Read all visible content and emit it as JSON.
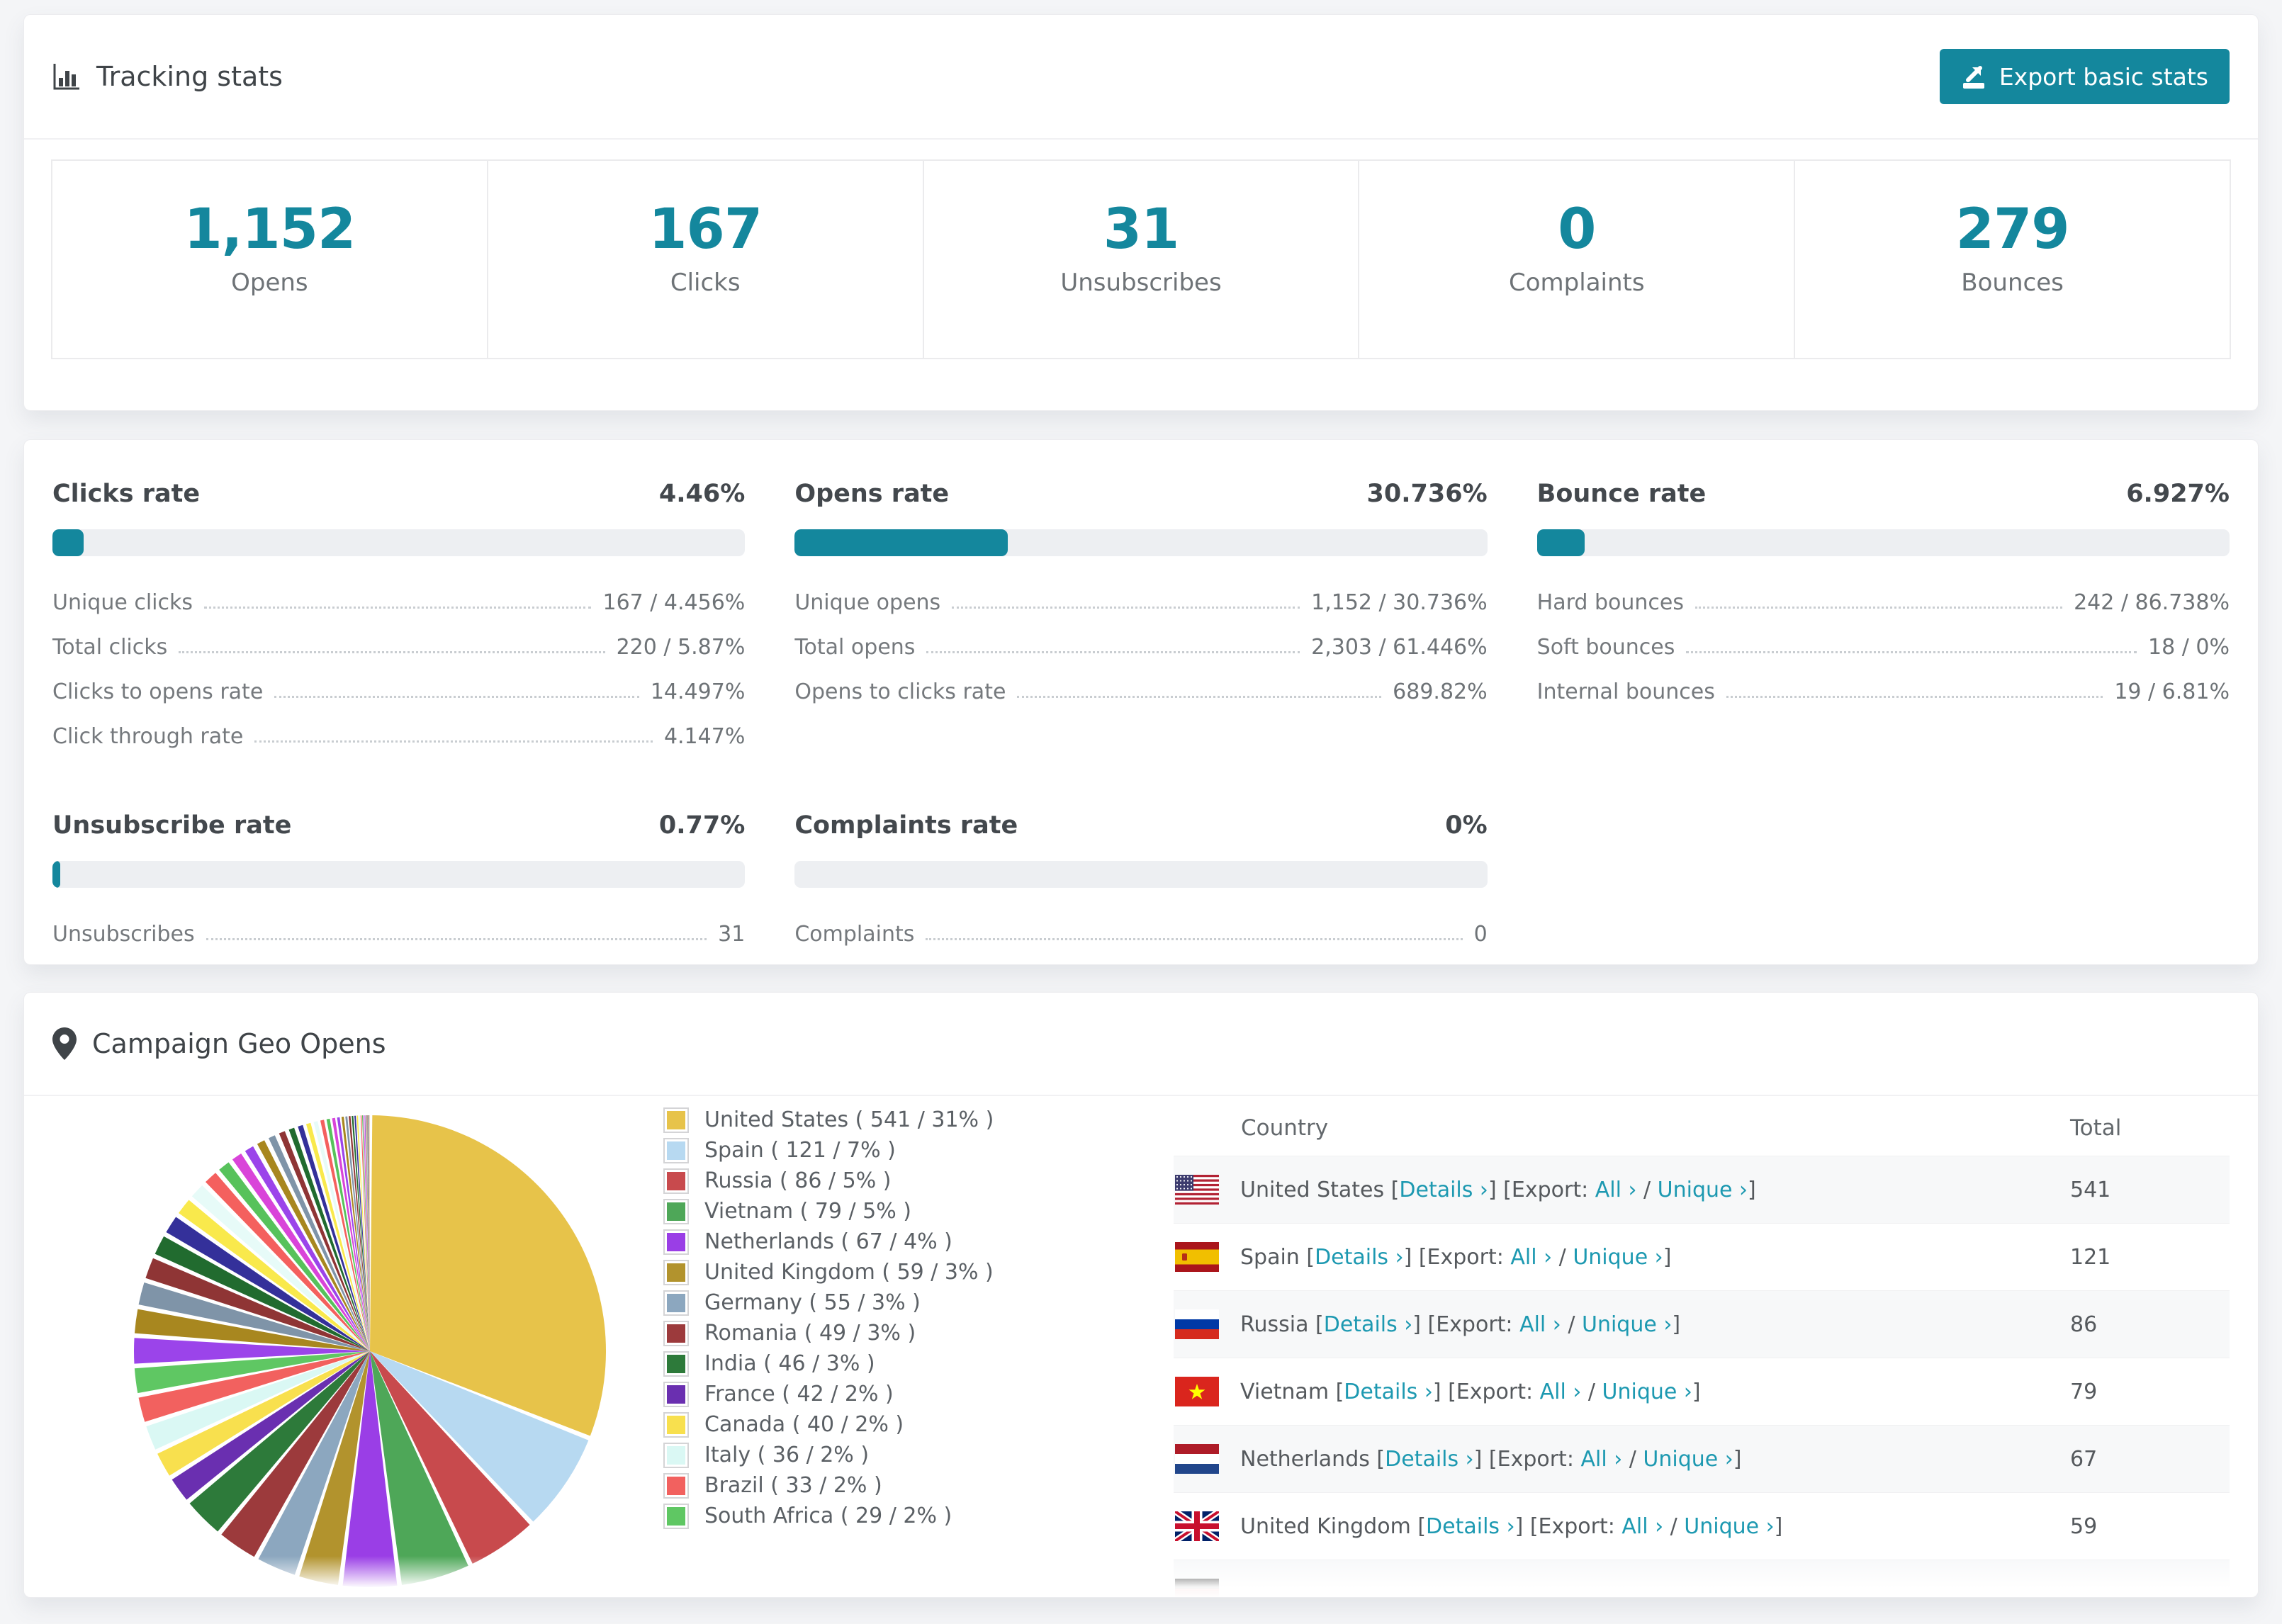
{
  "accent": "#14879d",
  "link_color": "#1d99b1",
  "tracking": {
    "title": "Tracking stats",
    "export_button": "Export basic stats",
    "stats": [
      {
        "value": "1,152",
        "label": "Opens"
      },
      {
        "value": "167",
        "label": "Clicks"
      },
      {
        "value": "31",
        "label": "Unsubscribes"
      },
      {
        "value": "0",
        "label": "Complaints"
      },
      {
        "value": "279",
        "label": "Bounces"
      }
    ]
  },
  "rates": {
    "blocks": [
      {
        "title": "Clicks rate",
        "value": "4.46%",
        "pct": 4.46,
        "rows": [
          [
            "Unique clicks",
            "167 / 4.456%"
          ],
          [
            "Total clicks",
            "220 / 5.87%"
          ],
          [
            "Clicks to opens rate",
            "14.497%"
          ],
          [
            "Click through rate",
            "4.147%"
          ]
        ]
      },
      {
        "title": "Opens rate",
        "value": "30.736%",
        "pct": 30.736,
        "rows": [
          [
            "Unique opens",
            "1,152 / 30.736%"
          ],
          [
            "Total opens",
            "2,303 / 61.446%"
          ],
          [
            "Opens to clicks rate",
            "689.82%"
          ]
        ]
      },
      {
        "title": "Bounce rate",
        "value": "6.927%",
        "pct": 6.927,
        "rows": [
          [
            "Hard bounces",
            "242 / 86.738%"
          ],
          [
            "Soft bounces",
            "18 / 0%"
          ],
          [
            "Internal bounces",
            "19 / 6.81%"
          ]
        ]
      },
      {
        "title": "Unsubscribe rate",
        "value": "0.77%",
        "pct": 0.77,
        "rows": [
          [
            "Unsubscribes",
            "31"
          ]
        ]
      },
      {
        "title": "Complaints rate",
        "value": "0%",
        "pct": 0,
        "rows": [
          [
            "Complaints",
            "0"
          ]
        ]
      }
    ]
  },
  "geo": {
    "title": "Campaign Geo Opens",
    "table": {
      "headers": [
        "Country",
        "Total"
      ],
      "tokens": {
        "open": "[",
        "close": "]",
        "export": "Export:",
        "slash": "/"
      },
      "links": {
        "details": "Details ›",
        "all": "All ›",
        "unique": "Unique ›"
      },
      "rows": [
        {
          "country": "United States",
          "flag": "us",
          "total": "541"
        },
        {
          "country": "Spain",
          "flag": "es",
          "total": "121"
        },
        {
          "country": "Russia",
          "flag": "ru",
          "total": "86"
        },
        {
          "country": "Vietnam",
          "flag": "vn",
          "total": "79"
        },
        {
          "country": "Netherlands",
          "flag": "nl",
          "total": "67"
        },
        {
          "country": "United Kingdom",
          "flag": "gb",
          "total": "59"
        },
        {
          "country": "",
          "flag": "de",
          "total": "",
          "partial": true
        }
      ]
    }
  },
  "chart_data": {
    "type": "pie",
    "title": "Campaign Geo Opens",
    "legend_position": "right",
    "start_angle_deg": 0,
    "slices": [
      {
        "label": "United States",
        "value": 541,
        "pct": 31,
        "color": "#e7c34a",
        "legend": "United States ( 541 / 31% )"
      },
      {
        "label": "Spain",
        "value": 121,
        "pct": 7,
        "color": "#b7d9f1",
        "legend": "Spain ( 121 / 7% )"
      },
      {
        "label": "Russia",
        "value": 86,
        "pct": 5,
        "color": "#c84a4d",
        "legend": "Russia ( 86 / 5% )"
      },
      {
        "label": "Vietnam",
        "value": 79,
        "pct": 5,
        "color": "#4ea758",
        "legend": "Vietnam ( 79 / 5% )"
      },
      {
        "label": "Netherlands",
        "value": 67,
        "pct": 4,
        "color": "#9a3ee6",
        "legend": "Netherlands ( 67 / 4% )"
      },
      {
        "label": "United Kingdom",
        "value": 59,
        "pct": 3,
        "color": "#b2932d",
        "legend": "United Kingdom ( 59 / 3% )"
      },
      {
        "label": "Germany",
        "value": 55,
        "pct": 3,
        "color": "#8ca7bf",
        "legend": "Germany ( 55 / 3% )"
      },
      {
        "label": "Romania",
        "value": 49,
        "pct": 3,
        "color": "#9c3a3c",
        "legend": "Romania ( 49 / 3% )"
      },
      {
        "label": "India",
        "value": 46,
        "pct": 3,
        "color": "#2d7a3a",
        "legend": "India ( 46 / 3% )"
      },
      {
        "label": "France",
        "value": 42,
        "pct": 2,
        "color": "#6a2fb0",
        "legend": "France ( 42 / 2% )"
      },
      {
        "label": "Canada",
        "value": 40,
        "pct": 2,
        "color": "#f8e04e",
        "legend": "Canada ( 40 / 2% )"
      },
      {
        "label": "Italy",
        "value": 36,
        "pct": 2,
        "color": "#daf8f4",
        "legend": "Italy ( 36 / 2% )"
      },
      {
        "label": "Brazil",
        "value": 33,
        "pct": 2,
        "color": "#f2615f",
        "legend": "Brazil ( 33 / 2% )"
      },
      {
        "label": "South Africa",
        "value": 29,
        "pct": 2,
        "color": "#5fc763",
        "legend": "South Africa ( 29 / 2% )"
      }
    ],
    "other_segments": {
      "note": "unlabeled small slices, approx relative weights, clockwise after South Africa",
      "weights": [
        1.0,
        0.95,
        0.9,
        0.85,
        0.8,
        0.75,
        0.7,
        0.65,
        0.6,
        0.55,
        0.5,
        0.46,
        0.42,
        0.38,
        0.35,
        0.32,
        0.29,
        0.26,
        0.23,
        0.21,
        0.19,
        0.17,
        0.15,
        0.13,
        0.115,
        0.1,
        0.09,
        0.08,
        0.07,
        0.06,
        0.052,
        0.045,
        0.04,
        0.035,
        0.03,
        0.026,
        0.022,
        0.019,
        0.016,
        0.013,
        0.011,
        0.009
      ],
      "colors": [
        "#9b44ea",
        "#a8871f",
        "#7f94a8",
        "#8f3535",
        "#216b2f",
        "#34309a",
        "#f9e94c",
        "#e7fbf8",
        "#f4605e",
        "#57c25b",
        "#d944d9"
      ]
    }
  }
}
